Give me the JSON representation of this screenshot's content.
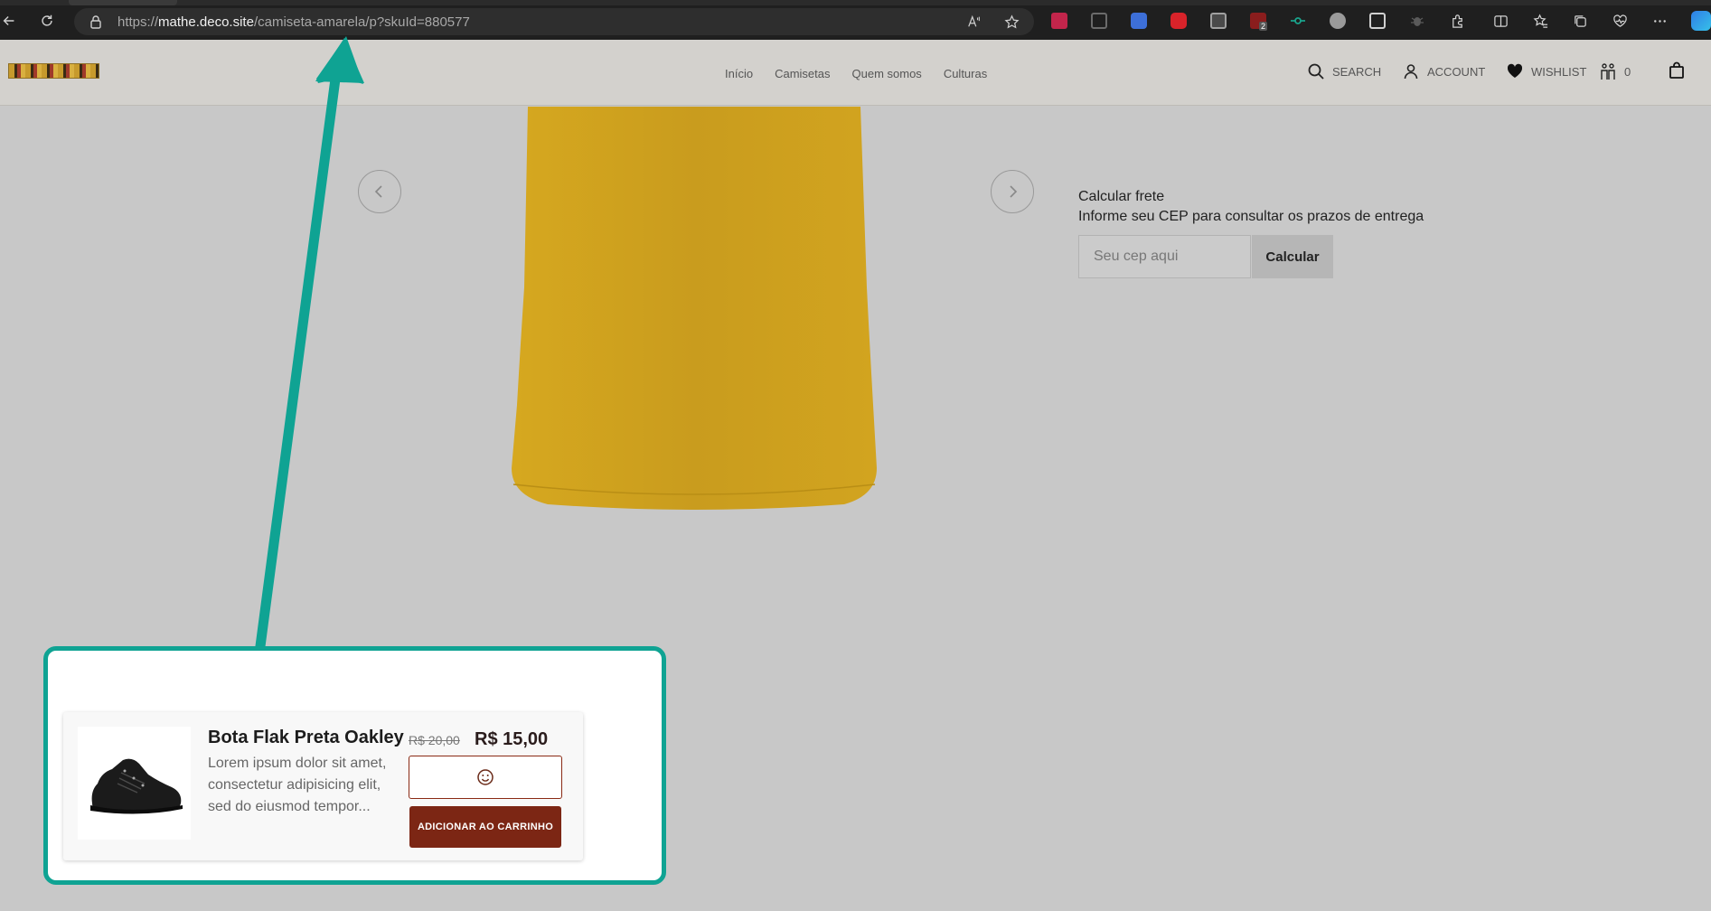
{
  "browser": {
    "url_scheme": "https://",
    "url_host": "mathe.deco.site",
    "url_path": "/camiseta-amarela/p?skuId=880577",
    "extension_badge": "2"
  },
  "site": {
    "nav": [
      "Início",
      "Camisetas",
      "Quem somos",
      "Culturas"
    ],
    "search_label": "SEARCH",
    "account_label": "ACCOUNT",
    "wishlist_label": "WISHLIST",
    "compare_count": "0"
  },
  "freight": {
    "title": "Calcular frete",
    "subtitle": "Informe seu CEP para consultar os prazos de entrega",
    "placeholder": "Seu cep aqui",
    "button": "Calcular"
  },
  "card": {
    "title": "Bota Flak Preta Oakley",
    "description": "Lorem ipsum dolor sit amet, consectetur adipisicing elit, sed do eiusmod tempor...",
    "price_old": "R$ 20,00",
    "price_new": "R$ 15,00",
    "add_to_cart": "ADICIONAR AO CARRINHO"
  },
  "colors": {
    "highlight": "#0fa393",
    "shirt": "#d4a320",
    "cart_button": "#7c2614"
  }
}
